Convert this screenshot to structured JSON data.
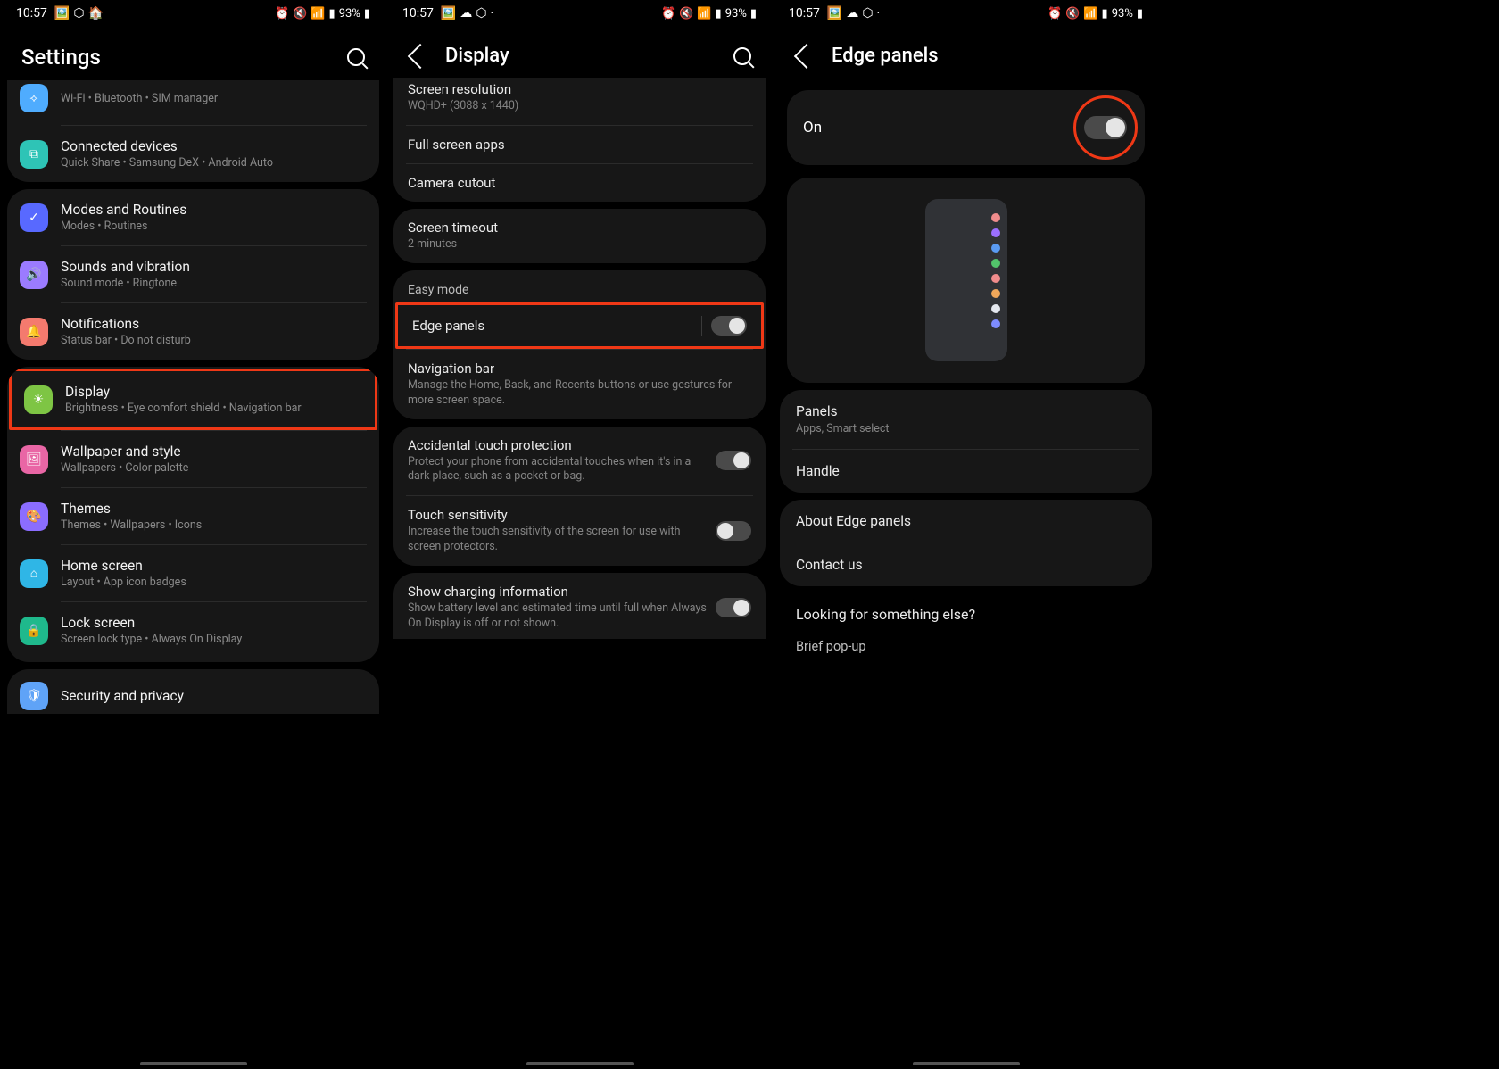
{
  "status": {
    "time": "10:57",
    "battery": "93%"
  },
  "screen1": {
    "title": "Settings",
    "groups": [
      [
        {
          "icon": "#4facfe",
          "title": "",
          "subtitle": "Wi-Fi  •  Bluetooth  •  SIM manager",
          "name": "connections"
        },
        {
          "icon": "#2ec4b6",
          "title": "Connected devices",
          "subtitle": "Quick Share  •  Samsung DeX  •  Android Auto",
          "name": "connected-devices"
        }
      ],
      [
        {
          "icon": "#5869ff",
          "title": "Modes and Routines",
          "subtitle": "Modes  •  Routines",
          "name": "modes-routines"
        },
        {
          "icon": "#9b7bff",
          "title": "Sounds and vibration",
          "subtitle": "Sound mode  •  Ringtone",
          "name": "sounds-vibration"
        },
        {
          "icon": "#f47a6e",
          "title": "Notifications",
          "subtitle": "Status bar  •  Do not disturb",
          "name": "notifications"
        }
      ],
      [
        {
          "icon": "#7ec544",
          "title": "Display",
          "subtitle": "Brightness  •  Eye comfort shield  •  Navigation bar",
          "name": "display",
          "highlight": true
        },
        {
          "icon": "#e966a5",
          "title": "Wallpaper and style",
          "subtitle": "Wallpapers  •  Color palette",
          "name": "wallpaper-style"
        },
        {
          "icon": "#8b6dff",
          "title": "Themes",
          "subtitle": "Themes  •  Wallpapers  •  Icons",
          "name": "themes"
        },
        {
          "icon": "#2fb6e6",
          "title": "Home screen",
          "subtitle": "Layout  •  App icon badges",
          "name": "home-screen"
        },
        {
          "icon": "#1fb98c",
          "title": "Lock screen",
          "subtitle": "Screen lock type  •  Always On Display",
          "name": "lock-screen"
        }
      ],
      [
        {
          "icon": "#5fa3f7",
          "title": "Security and privacy",
          "subtitle": "",
          "name": "security-privacy"
        }
      ]
    ]
  },
  "screen2": {
    "title": "Display",
    "groups": [
      {
        "type": "item",
        "title": "Screen resolution",
        "subtitle": "WQHD+ (3088 x 1440)",
        "name": "screen-resolution"
      },
      {
        "type": "item",
        "title": "Full screen apps",
        "name": "full-screen-apps"
      },
      {
        "type": "item",
        "title": "Camera cutout",
        "name": "camera-cutout"
      },
      {
        "type": "break"
      },
      {
        "type": "item",
        "title": "Screen timeout",
        "subtitle": "2 minutes",
        "name": "screen-timeout"
      },
      {
        "type": "break"
      },
      {
        "type": "section",
        "label": "Easy mode"
      },
      {
        "type": "toggle",
        "title": "Edge panels",
        "on": true,
        "highlight": true,
        "sep": true,
        "name": "edge-panels"
      },
      {
        "type": "item",
        "title": "Navigation bar",
        "subtitle": "Manage the Home, Back, and Recents buttons or use gestures for more screen space.",
        "name": "navigation-bar"
      },
      {
        "type": "break"
      },
      {
        "type": "toggle",
        "title": "Accidental touch protection",
        "subtitle": "Protect your phone from accidental touches when it's in a dark place, such as a pocket or bag.",
        "on": true,
        "name": "accidental-touch"
      },
      {
        "type": "toggle",
        "title": "Touch sensitivity",
        "subtitle": "Increase the touch sensitivity of the screen for use with screen protectors.",
        "on": false,
        "name": "touch-sensitivity"
      },
      {
        "type": "break"
      },
      {
        "type": "toggle",
        "title": "Show charging information",
        "subtitle": "Show battery level and estimated time until full when Always On Display is off or not shown.",
        "on": true,
        "name": "show-charging-info"
      }
    ]
  },
  "screen3": {
    "title": "Edge panels",
    "on_label": "On",
    "dots": [
      "#f08c8c",
      "#9b6fff",
      "#5a9bf2",
      "#52c46b",
      "#f08c8c",
      "#f0a75a",
      "#e4e8ef",
      "#7e8cff"
    ],
    "panels": {
      "title": "Panels",
      "subtitle": "Apps, Smart select"
    },
    "handle": {
      "title": "Handle"
    },
    "about": {
      "title": "About Edge panels"
    },
    "contact": {
      "title": "Contact us"
    },
    "looking_label": "Looking for something else?",
    "brief": "Brief pop-up"
  }
}
